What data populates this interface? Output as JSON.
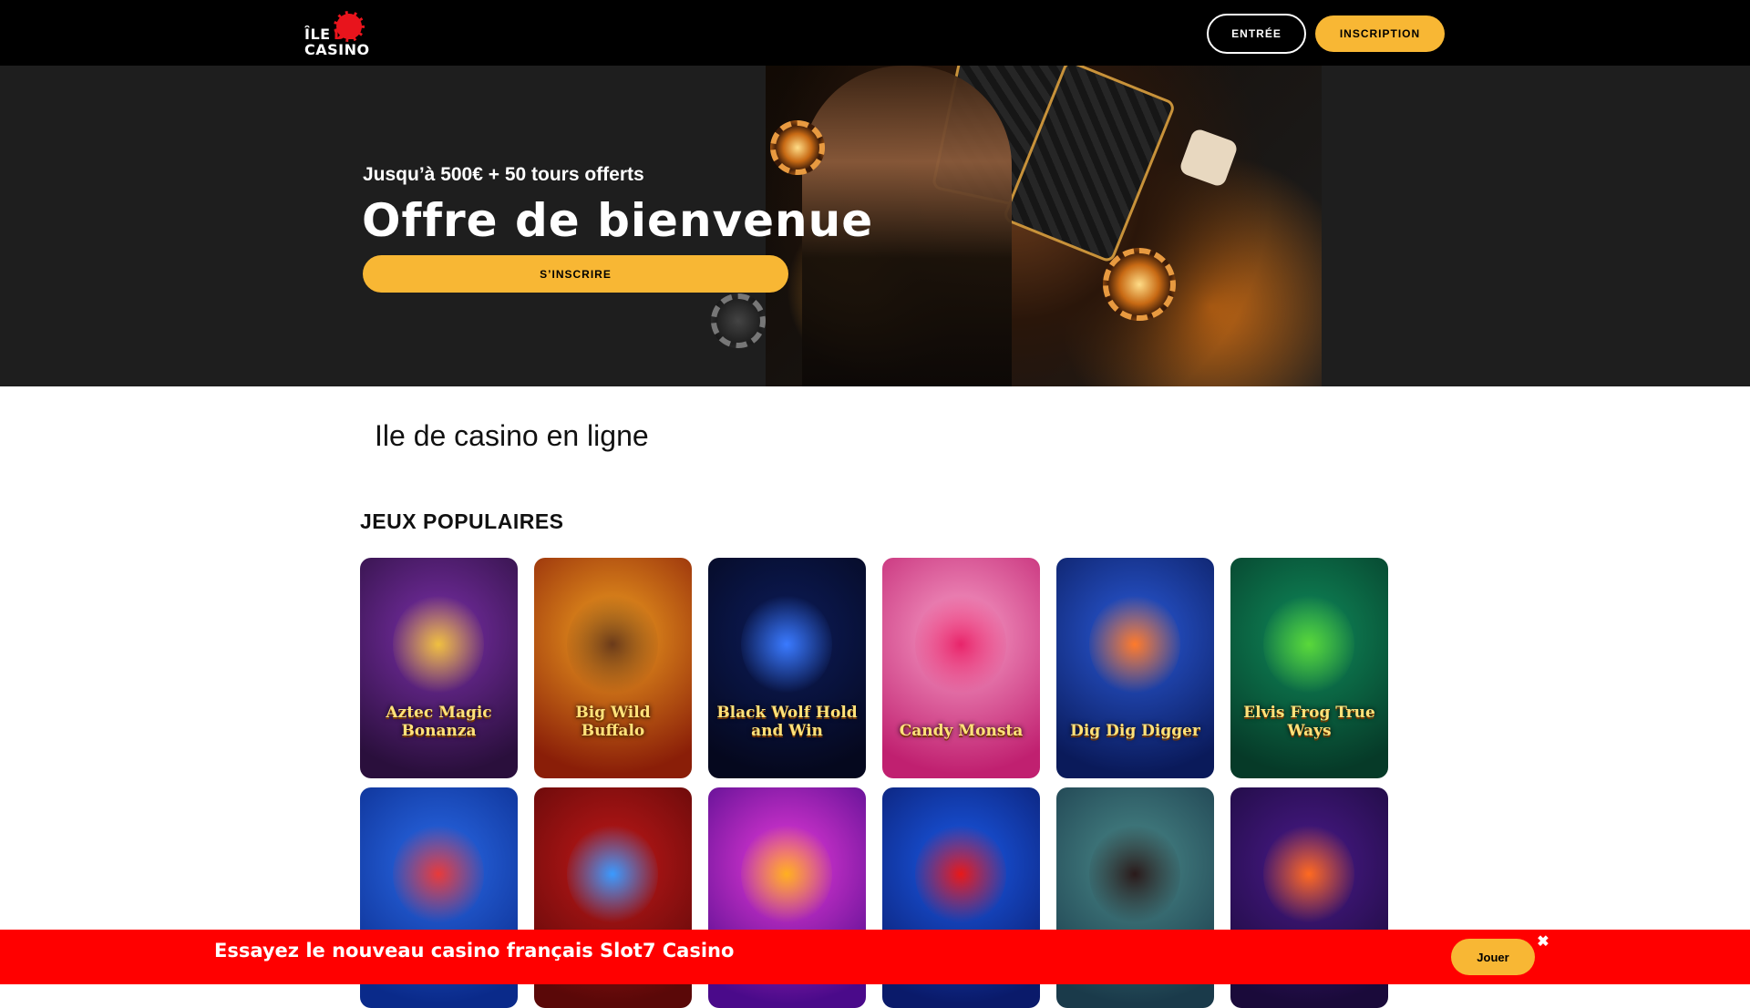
{
  "header": {
    "logo": {
      "line1": "ÎLE",
      "line2": "DE",
      "line3": "CASINO"
    },
    "login_label": "ENTRÉE",
    "register_label": "INSCRIPTION"
  },
  "hero": {
    "subtitle": "Jusqu’à 500€ + 50 tours offerts",
    "title": "Offre de bienvenue",
    "cta_label": "S’INSCRIRE"
  },
  "main": {
    "page_heading": "Ile de casino en ligne",
    "popular_title": "JEUX POPULAIRES",
    "games": [
      {
        "name": "Aztec Magic Bonanza",
        "bg1": "#7a2fa8",
        "bg2": "#2a0f3c",
        "accent": "#f0c040"
      },
      {
        "name": "Big Wild Buffalo",
        "bg1": "#f0a020",
        "bg2": "#8a1e08",
        "accent": "#6a3a1a"
      },
      {
        "name": "Black Wolf Hold and Win",
        "bg1": "#0c1c5a",
        "bg2": "#05081e",
        "accent": "#3a7aff"
      },
      {
        "name": "Candy Monsta",
        "bg1": "#f8a0c8",
        "bg2": "#c02070",
        "accent": "#e8246a"
      },
      {
        "name": "Dig Dig Digger",
        "bg1": "#2a5ad8",
        "bg2": "#0a1a5a",
        "accent": "#ff7a2a"
      },
      {
        "name": "Elvis Frog True Ways",
        "bg1": "#0f8a5a",
        "bg2": "#063a28",
        "accent": "#5ad83a"
      },
      {
        "name": "",
        "bg1": "#2a6ae8",
        "bg2": "#0a2a8a",
        "accent": "#e83a3a"
      },
      {
        "name": "",
        "bg1": "#c01818",
        "bg2": "#5a0808",
        "accent": "#3a9aff"
      },
      {
        "name": "",
        "bg1": "#e83ad8",
        "bg2": "#4a0a8a",
        "accent": "#ffb020"
      },
      {
        "name": "",
        "bg1": "#1a5ae8",
        "bg2": "#0a1a6a",
        "accent": "#e81818"
      },
      {
        "name": "",
        "bg1": "#4a8a8a",
        "bg2": "#1a3a4a",
        "accent": "#2a1a1a"
      },
      {
        "name": "",
        "bg1": "#4a1a8a",
        "bg2": "#1a0a3a",
        "accent": "#ff6a20"
      }
    ]
  },
  "promo": {
    "text": "Essayez le nouveau casino français Slot7 Casino",
    "button_label": "Jouer",
    "close_symbol": "✖"
  }
}
